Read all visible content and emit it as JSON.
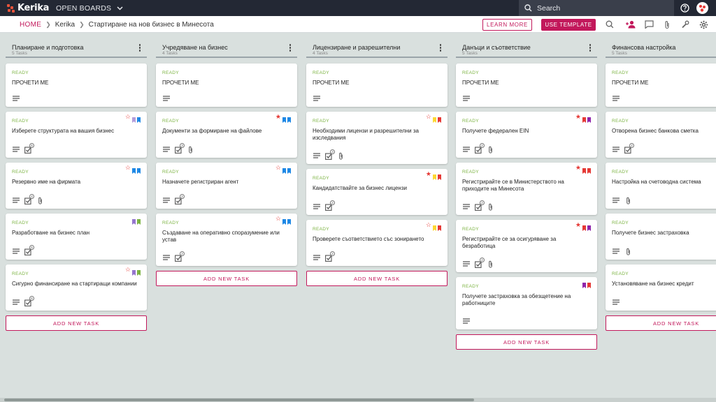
{
  "app": {
    "logo_text": "Kerika",
    "boards_menu": "OPEN BOARDS"
  },
  "search": {
    "placeholder": "Search"
  },
  "breadcrumb": {
    "home": "HOME",
    "account": "Kerika",
    "board": "Стартиране на нов бизнес в Минесота"
  },
  "actions": {
    "learn_more": "LEARN MORE",
    "use_template": "USE TEMPLATE"
  },
  "colors": {
    "accent": "#c2185b",
    "ready": "#7cb342",
    "topbar": "#232834",
    "background": "#d9e0de"
  },
  "columns": [
    {
      "title": "Планиране и подготовка",
      "count": "5 Tasks",
      "add_label": "ADD NEW TASK",
      "cards": [
        {
          "status": "READY",
          "title": "ПРОЧЕТИ МЕ",
          "star": "none",
          "flags": [],
          "icons": [
            "description-icon"
          ],
          "checklist": ""
        },
        {
          "status": "READY",
          "title": "Изберете структурата на вашия бизнес",
          "star": "outline",
          "flags": [
            "#b39ddb",
            "#1e88e5"
          ],
          "icons": [
            "description-icon",
            "checklist-icon"
          ],
          "checklist": "5"
        },
        {
          "status": "READY",
          "title": "Резервно име на фирмата",
          "star": "outline",
          "flags": [
            "#1e88e5",
            "#1e88e5"
          ],
          "icons": [
            "description-icon",
            "checklist-icon",
            "attachment-icon"
          ],
          "checklist": "4"
        },
        {
          "status": "READY",
          "title": "Разработване на бизнес план",
          "star": "none",
          "flags": [
            "#9575cd",
            "#7cb342"
          ],
          "icons": [
            "description-icon",
            "checklist-icon"
          ],
          "checklist": "5"
        },
        {
          "status": "READY",
          "title": "Сигурно финансиране на стартиращи компании",
          "star": "outline",
          "flags": [
            "#9575cd",
            "#7cb342"
          ],
          "icons": [
            "description-icon",
            "checklist-icon"
          ],
          "checklist": "6"
        }
      ]
    },
    {
      "title": "Учредяване на бизнес",
      "count": "4 Tasks",
      "add_label": "ADD NEW TASK",
      "cards": [
        {
          "status": "READY",
          "title": "ПРОЧЕТИ МЕ",
          "star": "none",
          "flags": [],
          "icons": [
            "description-icon"
          ],
          "checklist": ""
        },
        {
          "status": "READY",
          "title": "Документи за формиране на файлове",
          "star": "filled",
          "flags": [
            "#1e88e5",
            "#1e88e5"
          ],
          "icons": [
            "description-icon",
            "checklist-icon",
            "attachment-icon"
          ],
          "checklist": "3"
        },
        {
          "status": "READY",
          "title": "Назначете регистриран агент",
          "star": "outline",
          "flags": [
            "#1e88e5",
            "#1e88e5"
          ],
          "icons": [
            "description-icon",
            "checklist-icon"
          ],
          "checklist": "2"
        },
        {
          "status": "READY",
          "title": "Създаване на оперативно споразумение или устав",
          "star": "outline",
          "flags": [
            "#1e88e5",
            "#1e88e5"
          ],
          "icons": [
            "description-icon",
            "checklist-icon"
          ],
          "checklist": "2"
        }
      ]
    },
    {
      "title": "Лицензиране и разрешителни",
      "count": "4 Tasks",
      "add_label": "ADD NEW TASK",
      "cards": [
        {
          "status": "READY",
          "title": "ПРОЧЕТИ МЕ",
          "star": "none",
          "flags": [],
          "icons": [
            "description-icon"
          ],
          "checklist": ""
        },
        {
          "status": "READY",
          "title": "Необходими лицензи и разрешителни за изследвания",
          "star": "outline",
          "flags": [
            "#fdd835",
            "#e53935"
          ],
          "icons": [
            "description-icon",
            "checklist-icon",
            "attachment-icon"
          ],
          "checklist": "3"
        },
        {
          "status": "READY",
          "title": "Кандидатствайте за бизнес лицензи",
          "star": "filled",
          "flags": [
            "#fdd835",
            "#e53935"
          ],
          "icons": [
            "description-icon",
            "checklist-icon"
          ],
          "checklist": "2"
        },
        {
          "status": "READY",
          "title": "Проверете съответствието със зонирането",
          "star": "outline",
          "flags": [
            "#fdd835",
            "#e53935"
          ],
          "icons": [
            "description-icon",
            "checklist-icon"
          ],
          "checklist": "2"
        }
      ]
    },
    {
      "title": "Данъци и съответствие",
      "count": "5 Tasks",
      "add_label": "ADD NEW TASK",
      "cards": [
        {
          "status": "READY",
          "title": "ПРОЧЕТИ МЕ",
          "star": "none",
          "flags": [],
          "icons": [
            "description-icon"
          ],
          "checklist": ""
        },
        {
          "status": "READY",
          "title": "Получете федерален EIN",
          "star": "filled",
          "flags": [
            "#e53935",
            "#8e24aa"
          ],
          "icons": [
            "description-icon",
            "checklist-icon",
            "attachment-icon"
          ],
          "checklist": "2"
        },
        {
          "status": "READY",
          "title": "Регистрирайте се в Министерството на приходите на Минесота",
          "star": "filled",
          "flags": [
            "#e53935",
            "#e53935"
          ],
          "icons": [
            "description-icon",
            "checklist-icon",
            "attachment-icon"
          ],
          "checklist": "2"
        },
        {
          "status": "READY",
          "title": "Регистрирайте се за осигуряване за безработица",
          "star": "filled",
          "flags": [
            "#e53935",
            "#8e24aa"
          ],
          "icons": [
            "description-icon",
            "checklist-icon",
            "attachment-icon"
          ],
          "checklist": "2"
        },
        {
          "status": "READY",
          "title": "Получете застраховка за обезщетение на работниците",
          "star": "none",
          "flags": [
            "#8e24aa",
            "#e53935"
          ],
          "icons": [
            "description-icon"
          ],
          "checklist": ""
        }
      ]
    },
    {
      "title": "Финансова настройка",
      "count": "5 Tasks",
      "add_label": "ADD NEW TASK",
      "cards": [
        {
          "status": "READY",
          "title": "ПРОЧЕТИ МЕ",
          "star": "none",
          "flags": [],
          "icons": [
            "description-icon"
          ],
          "checklist": ""
        },
        {
          "status": "READY",
          "title": "Отворена бизнес банкова сметка",
          "star": "none",
          "flags": [],
          "icons": [
            "description-icon",
            "checklist-icon"
          ],
          "checklist": "2"
        },
        {
          "status": "READY",
          "title": "Настройка на счетоводна система",
          "star": "none",
          "flags": [],
          "icons": [
            "description-icon",
            "attachment-icon"
          ],
          "checklist": ""
        },
        {
          "status": "READY",
          "title": "Получете бизнес застраховка",
          "star": "none",
          "flags": [],
          "icons": [
            "description-icon",
            "attachment-icon"
          ],
          "checklist": ""
        },
        {
          "status": "READY",
          "title": "Установяване на бизнес кредит",
          "star": "none",
          "flags": [],
          "icons": [
            "description-icon"
          ],
          "checklist": ""
        }
      ]
    }
  ]
}
